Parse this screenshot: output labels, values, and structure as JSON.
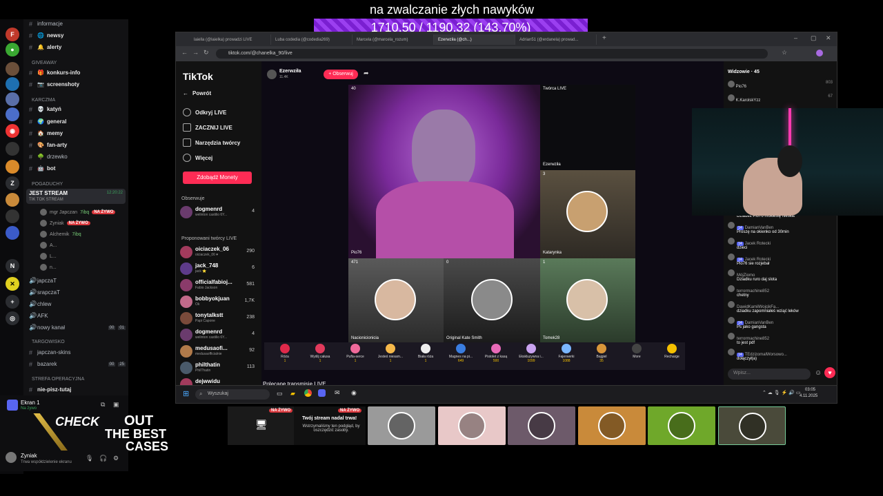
{
  "overlay": {
    "title": "na zwalczanie złych nawyków",
    "progress_text": "1710.50 / 1190.32 (143.70%)",
    "progress_percent": 143.7,
    "bar_color": "#8b2ee6"
  },
  "discord": {
    "channels_top": [
      {
        "name": "informacje",
        "icon": "info-icon"
      },
      {
        "name": "newsy",
        "icon": "globe-icon"
      },
      {
        "name": "alerty",
        "icon": "bell-icon"
      }
    ],
    "category_giveaway": "GIVEAWAY",
    "giveaway_channels": [
      {
        "name": "konkurs-info"
      },
      {
        "name": "screenshoty"
      }
    ],
    "category_karczma": "KARCZMA",
    "karczma_channels": [
      {
        "name": "katyń"
      },
      {
        "name": "general"
      },
      {
        "name": "memy"
      },
      {
        "name": "fan-arty"
      },
      {
        "name": "drzewko"
      },
      {
        "name": "bot"
      }
    ],
    "category_pogaduchy": "POGADUCHY",
    "voice_active": {
      "name": "JEST STREAM",
      "time": "12:20:22",
      "subtitle": "TIK TOK STREAM"
    },
    "voice_users": [
      {
        "name": "mgr Japczan",
        "tag": "7ibq",
        "live": "NA ŻYWO"
      },
      {
        "name": "Zyniak",
        "live": "NA ŻYWO"
      },
      {
        "name": "Alchemik",
        "tag": "7ibq"
      },
      {
        "name": "A..."
      },
      {
        "name": "L..."
      },
      {
        "name": "n..."
      }
    ],
    "voice_channels": [
      {
        "name": "japczaT"
      },
      {
        "name": "srapczaT"
      },
      {
        "name": "chlew"
      },
      {
        "name": "AFK"
      },
      {
        "name": "nowy kanał",
        "count": "00",
        "max": "01"
      }
    ],
    "category_targowisko": "TARGOWISKO",
    "targowisko_channels": [
      {
        "name": "japczan-skins"
      },
      {
        "name": "bazarek",
        "count": "00",
        "max": "25"
      }
    ],
    "category_strefa": "STREFA OPERACYJNA",
    "strefa_channels": [
      {
        "name": "nie-pisz-tutaj"
      }
    ],
    "screen_share": {
      "title": "Ekran 1",
      "status": "Na żywo"
    },
    "user": {
      "name": "Zyniak",
      "status": "Trwa współdzielenie ekranu"
    },
    "server_letters": [
      "Z",
      "N"
    ]
  },
  "promo": {
    "line1": "CHECK",
    "line2": "OUT",
    "line3": "THE BEST",
    "line4": "CASES"
  },
  "browser": {
    "tabs": [
      "laiella (@laielka) prowadzi LIVE",
      "Luba codedia (@codedia269)",
      "Marcela (@marcela_rozum)",
      "Ezerwziła (@ch...)",
      "Adrian51 (@erdanela) prowad..."
    ],
    "url": "tiktok.com/@chanelka_90/live"
  },
  "tiktok": {
    "logo": "TikTok",
    "back": "Powrót",
    "nav": [
      "Odkryj LIVE",
      "ZACZNIJ LIVE",
      "Narzędzia twórcy",
      "Więcej"
    ],
    "coins_button": "Zdobądź Monety",
    "observe_header": "Obserwuje",
    "observed": [
      {
        "name": "dogmenrd",
        "sub": "welinton castilio 6Y...",
        "count": "4"
      }
    ],
    "suggested_header": "Proponowani twórcy LIVE",
    "suggested": [
      {
        "name": "oiciaczek_06",
        "sub": "oiciaczek_06 ♥",
        "count": "290"
      },
      {
        "name": "jack_748",
        "sub": "jack ⭐",
        "count": "6"
      },
      {
        "name": "officialfabioj...",
        "sub": "Fabio Jackson",
        "count": "581"
      },
      {
        "name": "bobbyokjuan",
        "sub": "Ok",
        "count": "1,7K"
      },
      {
        "name": "tonytalkstt",
        "sub": "Papi Capone",
        "count": "238"
      },
      {
        "name": "dogmenrd",
        "sub": "welinton castilio 6Y...",
        "count": "4"
      },
      {
        "name": "medusaofi...",
        "sub": "medusaofficialnie",
        "count": "92"
      },
      {
        "name": "philthatin",
        "sub": "PhilThatin",
        "count": "113"
      },
      {
        "name": "dejwwidu",
        "sub": "",
        "count": ""
      }
    ],
    "host": {
      "name": "Ezerwziła",
      "sub": "11.4K",
      "follow": "+ Obserwuj"
    },
    "tiles": [
      {
        "name": "Pio76",
        "count": "40"
      },
      {
        "name": "Twórca LIVE",
        "count": ""
      },
      {
        "name": "Ezerwziła",
        "count": ""
      },
      {
        "name": "Katarynka",
        "count": "3"
      },
      {
        "name": "Nacionicionicia",
        "count": "471"
      },
      {
        "name": "Original Kate Smith",
        "count": "0"
      },
      {
        "name": "Tomek28",
        "count": "1"
      }
    ],
    "gifts": [
      {
        "name": "Róża",
        "price": "1",
        "color": "#e0294a"
      },
      {
        "name": "Wyślij całusa",
        "price": "1",
        "color": "#e23a5c"
      },
      {
        "name": "Pufta-serce",
        "price": "1",
        "color": "#f06a9a"
      },
      {
        "name": "Jesteś niesam...",
        "price": "1",
        "color": "#f5b84a"
      },
      {
        "name": "Biała róża",
        "price": "1",
        "color": "#eeeeee"
      },
      {
        "name": "Magnes na pi...",
        "price": "649",
        "color": "#3a7de0"
      },
      {
        "name": "Pistolet z kasą",
        "price": "500",
        "color": "#e86ab8"
      },
      {
        "name": "Ekskluzywna i...",
        "price": "1099",
        "color": "#c9a2f0"
      },
      {
        "name": "Fajerwerki",
        "price": "1088",
        "color": "#7ab6ff"
      },
      {
        "name": "Bajgiel",
        "price": "35",
        "color": "#d9963a"
      },
      {
        "name": "More",
        "price": "",
        "color": "#444444"
      },
      {
        "name": "Recharge",
        "price": "",
        "color": "#f5c000"
      }
    ],
    "recommended": "Polecane transmisje LIVE",
    "viewers_header": "Widzowie · 45",
    "viewers": [
      {
        "name": "Pio76",
        "score": "803"
      },
      {
        "name": "K.KarolskYzz",
        "score": "67"
      }
    ],
    "chat": [
      {
        "user": "Jacek Rotecki",
        "level": "14",
        "text": "Dziadek Pio76 mokiesię nieśkie"
      },
      {
        "user": "DamianVanBen",
        "level": "14",
        "text": "Proszę na okienko od 30min"
      },
      {
        "user": "Jacek Rotecki",
        "level": "14",
        "text": "dzieci"
      },
      {
        "user": "Jacek Rotecki",
        "level": "14",
        "text": "Pio76 sie rozjebał"
      },
      {
        "user": "MójZiomo",
        "level": "",
        "text": "Dziadku ruro daj slota"
      },
      {
        "user": "terrormachine852",
        "level": "",
        "text": "chetny"
      },
      {
        "user": "DawidKamilWojcikFa...",
        "level": "",
        "text": "dziadku zapomniałeś wziąć leków"
      },
      {
        "user": "DamianVanBen",
        "level": "14",
        "text": "Ps jako gangsta"
      },
      {
        "user": "terrormachine852",
        "level": "",
        "text": "to jest pdf"
      },
      {
        "user": "TEdzizomalWorsowo...",
        "level": "14",
        "text": "dołączył(a)"
      }
    ],
    "chat_placeholder": "Wpisz..."
  },
  "taskbar": {
    "search": "Wyszukaj",
    "time": "03:05",
    "date": "4.11.2025"
  },
  "stream_cards": {
    "live_label": "NA ŻYWO",
    "card_title": "Twój stream nadal trwa!",
    "card_text": "Wstrzymaliśmy ten podgląd, by oszczędzić zasoby.",
    "thumb_colors": [
      "#9a9a9a",
      "#e8c8c8",
      "#6d5a6a",
      "#c98a3a",
      "#6fa82a",
      "#4a4a3a"
    ]
  }
}
